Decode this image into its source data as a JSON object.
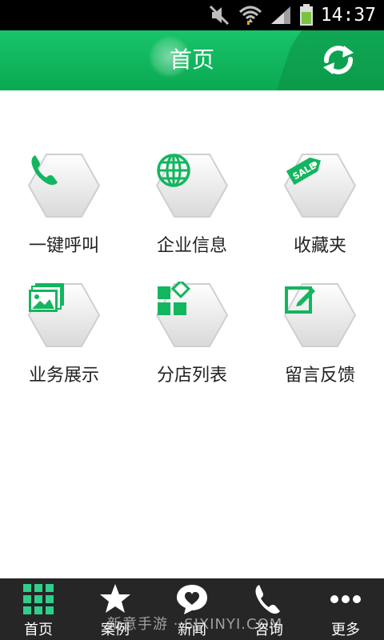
{
  "status_bar": {
    "time": "14:37"
  },
  "header": {
    "title": "首页"
  },
  "grid": {
    "items": [
      {
        "label": "一键呼叫",
        "icon": "phone-icon"
      },
      {
        "label": "企业信息",
        "icon": "globe-icon"
      },
      {
        "label": "收藏夹",
        "icon": "sale-tag-icon"
      },
      {
        "label": "业务展示",
        "icon": "gallery-icon"
      },
      {
        "label": "分店列表",
        "icon": "app-blocks-icon"
      },
      {
        "label": "留言反馈",
        "icon": "edit-note-icon"
      }
    ]
  },
  "tabbar": {
    "tabs": [
      {
        "label": "首页",
        "icon": "grid-icon"
      },
      {
        "label": "案例",
        "icon": "star-icon"
      },
      {
        "label": "新闻",
        "icon": "heart-bubble-icon"
      },
      {
        "label": "咨询",
        "icon": "phone-icon"
      },
      {
        "label": "更多",
        "icon": "more-dots-icon"
      }
    ]
  },
  "watermark": "新意手游 · SJXINYI.COM",
  "colors": {
    "accent": "#13b65f",
    "header_dark": "#0b8f43",
    "tabbar": "#262626"
  }
}
